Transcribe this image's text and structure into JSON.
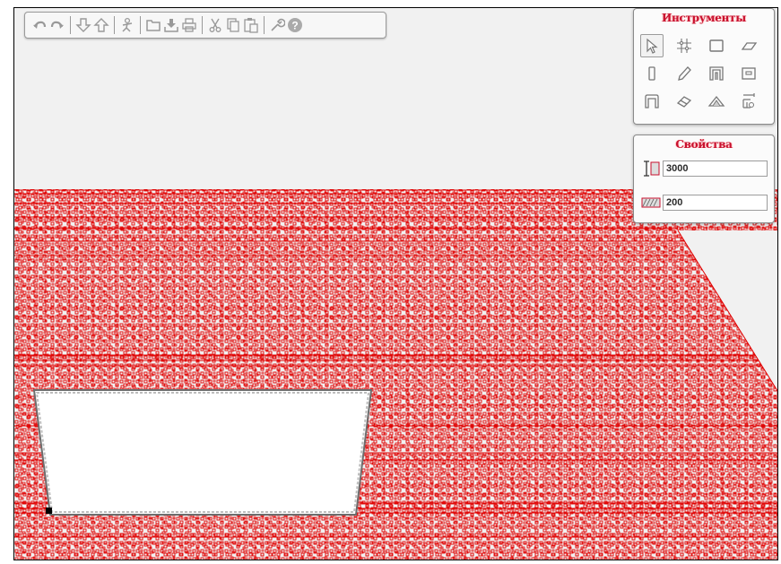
{
  "toolbar": {
    "buttons": [
      {
        "icon": "undo-icon"
      },
      {
        "icon": "redo-icon"
      },
      {
        "icon": "arrow-down-icon"
      },
      {
        "icon": "arrow-up-icon"
      },
      {
        "icon": "person-icon"
      },
      {
        "icon": "folder-icon"
      },
      {
        "icon": "import-icon"
      },
      {
        "icon": "print-icon"
      },
      {
        "icon": "cut-icon"
      },
      {
        "icon": "copy-icon"
      },
      {
        "icon": "paste-icon"
      },
      {
        "icon": "wrench-icon"
      },
      {
        "icon": "help-icon"
      }
    ]
  },
  "tools_panel": {
    "title": "Инструменты",
    "tools": [
      {
        "icon": "select-arrow-icon",
        "active": true
      },
      {
        "icon": "grid-points-icon",
        "active": false
      },
      {
        "icon": "rectangle-icon",
        "active": false
      },
      {
        "icon": "slab-icon",
        "active": false
      },
      {
        "icon": "column-icon",
        "active": false
      },
      {
        "icon": "pencil-icon",
        "active": false
      },
      {
        "icon": "door-icon",
        "active": false
      },
      {
        "icon": "window-icon",
        "active": false
      },
      {
        "icon": "arch-icon",
        "active": false
      },
      {
        "icon": "eraser-icon",
        "active": false
      },
      {
        "icon": "roof-icon",
        "active": false
      },
      {
        "icon": "measure-icon",
        "active": false
      }
    ]
  },
  "properties_panel": {
    "title": "Свойства",
    "height_value": "3000",
    "thickness_value": "200"
  },
  "colors": {
    "accent": "#c8102e",
    "wall_mark": "#ff0000",
    "background": "#f1f1f1"
  }
}
